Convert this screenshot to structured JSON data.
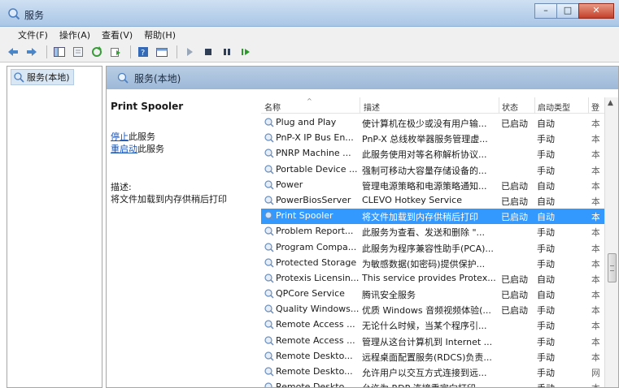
{
  "window": {
    "title": "服务",
    "minimize": "–",
    "maximize": "□",
    "close": "✕"
  },
  "menu": [
    "文件(F)",
    "操作(A)",
    "查看(V)",
    "帮助(H)"
  ],
  "toolbar_icons": [
    "back-icon",
    "forward-icon",
    "console-tree-icon",
    "properties-icon",
    "refresh-icon",
    "export-icon",
    "help-icon",
    "console-icon",
    "play-icon",
    "stop-icon",
    "pause-icon",
    "resume-icon"
  ],
  "tree": {
    "item": "服务(本地)"
  },
  "pane": {
    "header": "服务(本地)",
    "selected_service": "Print Spooler",
    "stop_link": "停止",
    "stop_suffix": "此服务",
    "restart_link": "重启动",
    "restart_suffix": "此服务",
    "desc_label": "描述:",
    "desc_text": "将文件加载到内存供稍后打印"
  },
  "columns": {
    "name": "名称",
    "desc": "描述",
    "status": "状态",
    "start": "启动类型",
    "extra": "登"
  },
  "rows": [
    {
      "name": "Plug and Play",
      "desc": "使计算机在极少或没有用户输...",
      "status": "已启动",
      "start": "自动",
      "extra": "本"
    },
    {
      "name": "PnP-X IP Bus En...",
      "desc": "PnP-X 总线枚举器服务管理虚...",
      "status": "",
      "start": "手动",
      "extra": "本"
    },
    {
      "name": "PNRP Machine ...",
      "desc": "此服务使用对等名称解析协议...",
      "status": "",
      "start": "手动",
      "extra": "本"
    },
    {
      "name": "Portable Device ...",
      "desc": "强制可移动大容量存储设备的...",
      "status": "",
      "start": "手动",
      "extra": "本"
    },
    {
      "name": "Power",
      "desc": "管理电源策略和电源策略通知...",
      "status": "已启动",
      "start": "自动",
      "extra": "本"
    },
    {
      "name": "PowerBiosServer",
      "desc": "CLEVO Hotkey Service",
      "status": "已启动",
      "start": "自动",
      "extra": "本"
    },
    {
      "name": "Print Spooler",
      "desc": "将文件加载到内存供稍后打印",
      "status": "已启动",
      "start": "自动",
      "extra": "本",
      "selected": true
    },
    {
      "name": "Problem Report...",
      "desc": "此服务为查看、发送和删除 \"...",
      "status": "",
      "start": "手动",
      "extra": "本"
    },
    {
      "name": "Program Compa...",
      "desc": "此服务为程序兼容性助手(PCA)...",
      "status": "",
      "start": "手动",
      "extra": "本"
    },
    {
      "name": "Protected Storage",
      "desc": "为敏感数据(如密码)提供保护...",
      "status": "",
      "start": "手动",
      "extra": "本"
    },
    {
      "name": "Protexis Licensin...",
      "desc": "This service provides Protex...",
      "status": "已启动",
      "start": "自动",
      "extra": "本"
    },
    {
      "name": "QPCore Service",
      "desc": "腾讯安全服务",
      "status": "已启动",
      "start": "自动",
      "extra": "本"
    },
    {
      "name": "Quality Windows...",
      "desc": "优质 Windows 音频视频体验(...",
      "status": "已启动",
      "start": "手动",
      "extra": "本"
    },
    {
      "name": "Remote Access ...",
      "desc": "无论什么时候，当某个程序引...",
      "status": "",
      "start": "手动",
      "extra": "本"
    },
    {
      "name": "Remote Access ...",
      "desc": "管理从这台计算机到 Internet ...",
      "status": "",
      "start": "手动",
      "extra": "本"
    },
    {
      "name": "Remote Deskto...",
      "desc": "远程桌面配置服务(RDCS)负责...",
      "status": "",
      "start": "手动",
      "extra": "本"
    },
    {
      "name": "Remote Deskto...",
      "desc": "允许用户以交互方式连接到远...",
      "status": "",
      "start": "手动",
      "extra": "网"
    },
    {
      "name": "Remote Deskto...",
      "desc": "允许为 RDP 连接重定向打印...",
      "status": "",
      "start": "手动",
      "extra": "本"
    }
  ],
  "colors": {
    "selection": "#3399ff",
    "link": "#1a55b8",
    "header": "#a9c6e6"
  }
}
